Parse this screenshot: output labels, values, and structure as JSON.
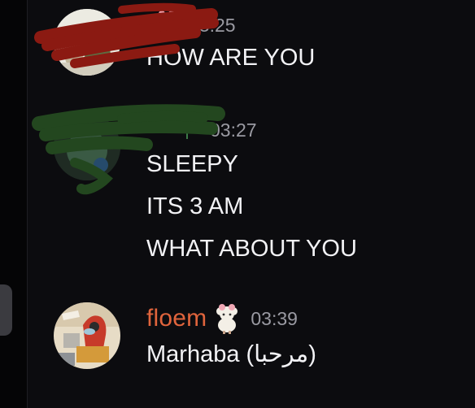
{
  "messages": [
    {
      "username": "",
      "timestamp": "03:25",
      "lines": [
        "HOW ARE YOU"
      ],
      "badge_icon": "sheep-badge-icon",
      "name_color": "#c9c9d0"
    },
    {
      "username": "",
      "timestamp": "03:27",
      "lines": [
        "SLEEPY",
        "ITS 3 AM",
        "WHAT ABOUT YOU"
      ],
      "badge_icon": "plant-badge-icon",
      "name_color": "#c9c9d0"
    },
    {
      "username": "floem",
      "timestamp": "03:39",
      "lines": [
        "Marhaba (مرحبا)"
      ],
      "badge_icon": "sheep-badge-icon",
      "name_color": "#e0643c"
    }
  ],
  "redactions": {
    "message_1_color": "#8b1a12",
    "message_2_color": "#23471f"
  }
}
